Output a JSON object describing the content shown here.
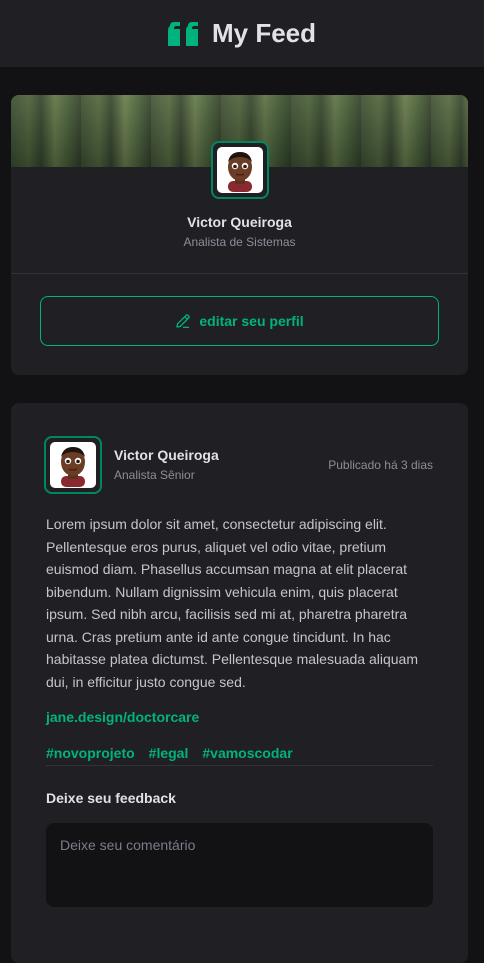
{
  "header": {
    "title": "My Feed",
    "logo_icon": "quote-icon",
    "brand_color": "#00B37E"
  },
  "profile": {
    "name": "Victor Queiroga",
    "role": "Analista de Sistemas",
    "edit_button": {
      "label": "editar seu perfil",
      "icon": "pencil-icon"
    }
  },
  "post": {
    "author": {
      "name": "Victor Queiroga",
      "role": "Analista Sênior"
    },
    "published": "Publicado há 3 dias",
    "content": "Lorem ipsum dolor sit amet, consectetur adipiscing elit. Pellentesque eros purus, aliquet vel odio vitae, pretium euismod diam. Phasellus accumsan magna at elit placerat bibendum. Nullam dignissim vehicula enim, quis placerat ipsum. Sed nibh arcu, facilisis sed mi at, pharetra pharetra urna. Cras pretium ante id ante congue tincidunt. In hac habitasse platea dictumst. Pellentesque malesuada aliquam dui, in efficitur justo congue sed.",
    "link": "jane.design/doctorcare",
    "hashtags": [
      "#novoprojeto",
      "#legal",
      "#vamoscodar"
    ],
    "feedback": {
      "title": "Deixe seu feedback",
      "placeholder": "Deixe seu comentário"
    }
  }
}
